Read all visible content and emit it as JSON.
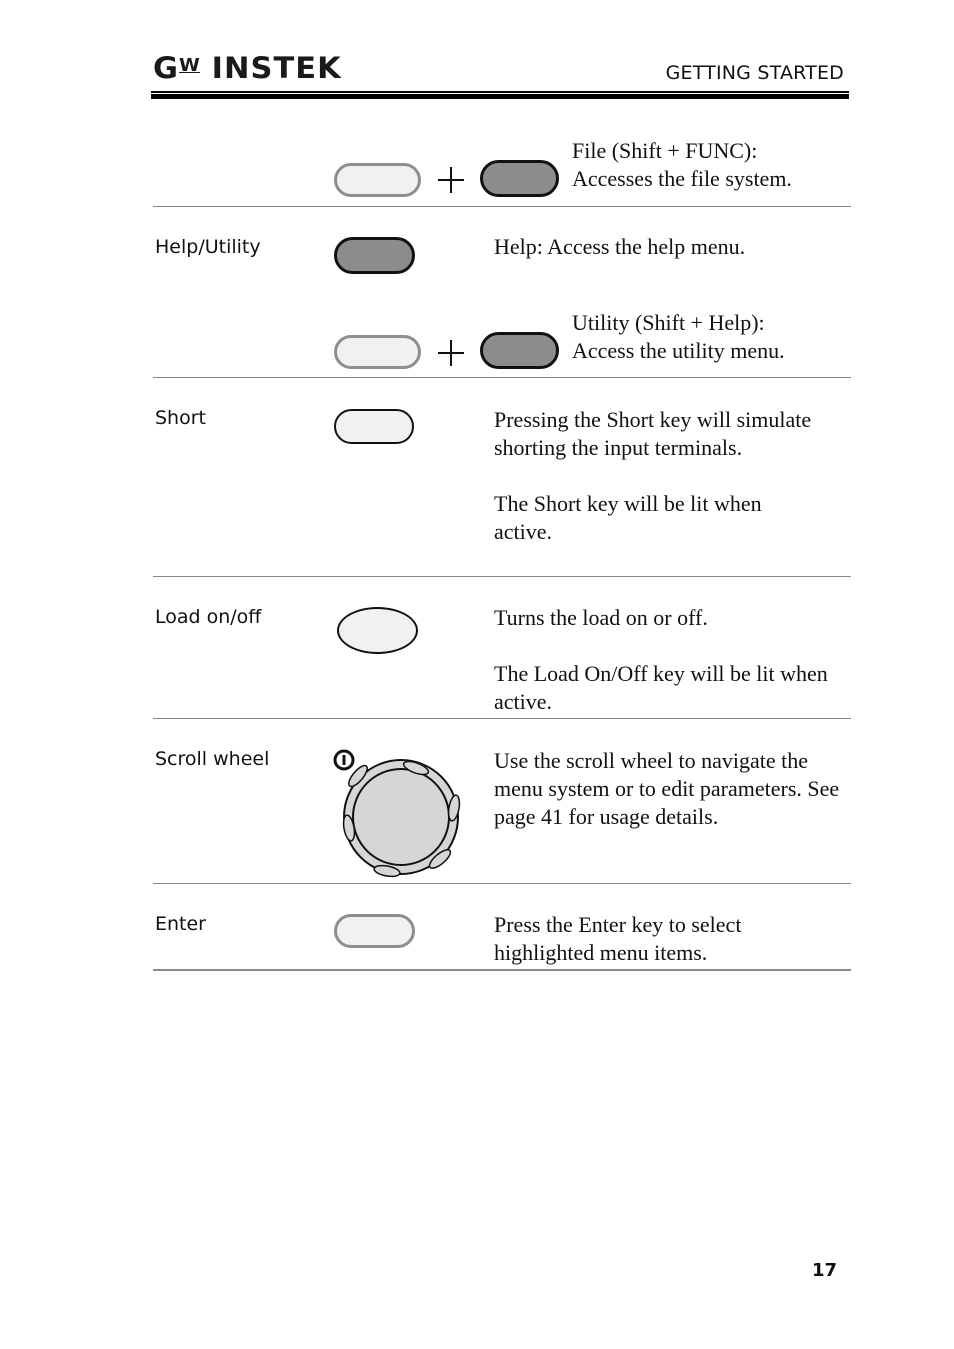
{
  "header": {
    "logo_main": "G",
    "logo_w": "W",
    "logo_rest": "INSTEK",
    "section_title": "GETTING STARTED"
  },
  "rows": [
    {
      "label": "",
      "keys": [
        "shift-key",
        "func-key"
      ],
      "description": [
        "File (Shift + FUNC):",
        "Accesses the file system."
      ]
    },
    {
      "label": "Help/Utility",
      "keys": [
        "help-key"
      ],
      "description": [
        "Help: Access the help menu."
      ]
    },
    {
      "label": "",
      "keys": [
        "shift-key",
        "help-key"
      ],
      "description": [
        "Utility (Shift + Help):",
        "Access the utility menu."
      ]
    },
    {
      "label": "Short",
      "keys": [
        "short-key"
      ],
      "description": [
        "Pressing the Short key will simulate shorting the input terminals.",
        "The Short key will be lit when active."
      ]
    },
    {
      "label": "Load on/off",
      "keys": [
        "load-key"
      ],
      "description": [
        "Turns the load on or off.",
        "The Load On/Off key will be lit when active."
      ]
    },
    {
      "label": "Scroll wheel",
      "keys": [
        "scroll-wheel"
      ],
      "description": [
        "Use the scroll wheel to navigate the menu system or to edit parameters. See page 41 for usage details."
      ]
    },
    {
      "label": "Enter",
      "keys": [
        "enter-key"
      ],
      "description": [
        "Press the Enter key to select highlighted menu items."
      ]
    }
  ],
  "footer": {
    "page_number": "17"
  }
}
